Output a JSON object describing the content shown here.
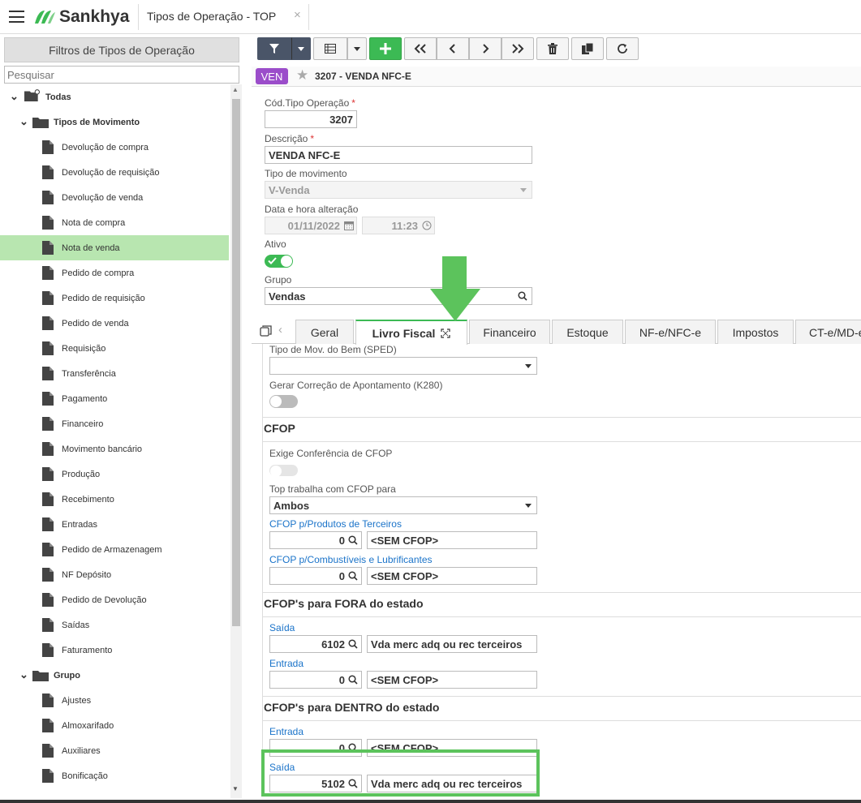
{
  "app": {
    "brand": "Sankhya",
    "doc_tab": "Tipos de Operação - TOP",
    "close": "×"
  },
  "colors": {
    "accent": "#3cba54",
    "badge": "#9b4dca",
    "selection": "#b8e6b0",
    "link": "#1a73c9"
  },
  "left": {
    "header": "Filtros de Tipos de Operação",
    "search_placeholder": "Pesquisar",
    "tree": [
      {
        "label": "Todas",
        "level": 0,
        "type": "root"
      },
      {
        "label": "Tipos de Movimento",
        "level": 1,
        "type": "folder"
      },
      {
        "label": "Devolução de compra",
        "level": 2,
        "type": "file"
      },
      {
        "label": "Devolução de requisição",
        "level": 2,
        "type": "file"
      },
      {
        "label": "Devolução de venda",
        "level": 2,
        "type": "file"
      },
      {
        "label": "Nota de compra",
        "level": 2,
        "type": "file"
      },
      {
        "label": "Nota de venda",
        "level": 2,
        "type": "file",
        "selected": true
      },
      {
        "label": "Pedido de compra",
        "level": 2,
        "type": "file"
      },
      {
        "label": "Pedido de requisição",
        "level": 2,
        "type": "file"
      },
      {
        "label": "Pedido de venda",
        "level": 2,
        "type": "file"
      },
      {
        "label": "Requisição",
        "level": 2,
        "type": "file"
      },
      {
        "label": "Transferência",
        "level": 2,
        "type": "file"
      },
      {
        "label": "Pagamento",
        "level": 2,
        "type": "file"
      },
      {
        "label": "Financeiro",
        "level": 2,
        "type": "file"
      },
      {
        "label": "Movimento bancário",
        "level": 2,
        "type": "file"
      },
      {
        "label": "Produção",
        "level": 2,
        "type": "file"
      },
      {
        "label": "Recebimento",
        "level": 2,
        "type": "file"
      },
      {
        "label": "Entradas",
        "level": 2,
        "type": "file"
      },
      {
        "label": "Pedido de Armazenagem",
        "level": 2,
        "type": "file"
      },
      {
        "label": "NF Depósito",
        "level": 2,
        "type": "file"
      },
      {
        "label": "Pedido de Devolução",
        "level": 2,
        "type": "file"
      },
      {
        "label": "Saídas",
        "level": 2,
        "type": "file"
      },
      {
        "label": "Faturamento",
        "level": 2,
        "type": "file"
      },
      {
        "label": "Grupo",
        "level": 1,
        "type": "folder"
      },
      {
        "label": "Ajustes",
        "level": 2,
        "type": "file"
      },
      {
        "label": "Almoxarifado",
        "level": 2,
        "type": "file"
      },
      {
        "label": "Auxiliares",
        "level": 2,
        "type": "file"
      },
      {
        "label": "Bonificação",
        "level": 2,
        "type": "file"
      }
    ]
  },
  "record": {
    "badge": "VEN",
    "title": "3207 - VENDA NFC-E"
  },
  "form": {
    "cod_label": "Cód.Tipo Operação",
    "cod_value": "3207",
    "req": "*",
    "desc_label": "Descrição",
    "desc_value": "VENDA NFC-E",
    "tipo_label": "Tipo de movimento",
    "tipo_value": "V-Venda",
    "data_label": "Data e hora alteração",
    "data_value": "01/11/2022",
    "hora_value": "11:23",
    "ativo_label": "Ativo",
    "grupo_label": "Grupo",
    "grupo_value": "Vendas"
  },
  "tabs": [
    "Geral",
    "Livro Fiscal",
    "Financeiro",
    "Estoque",
    "NF-e/NFC-e",
    "Impostos",
    "CT-e/MD-e"
  ],
  "fiscal": {
    "sped_label": "Tipo de Mov. do Bem (SPED)",
    "k280_label": "Gerar Correção de Apontamento (K280)",
    "cfop_title": "CFOP",
    "exige_label": "Exige Conferência de CFOP",
    "top_label": "Top trabalha com CFOP para",
    "top_value": "Ambos",
    "terc_label": "CFOP p/Produtos de Terceiros",
    "terc_code": "0",
    "terc_desc": "<SEM CFOP>",
    "comb_label": "CFOP p/Combustíveis e Lubrificantes",
    "comb_code": "0",
    "comb_desc": "<SEM CFOP>",
    "fora_title": "CFOP's para FORA do estado",
    "fora_saida_label": "Saída",
    "fora_saida_code": "6102",
    "fora_saida_desc": "Vda merc adq ou rec terceiros",
    "fora_entrada_label": "Entrada",
    "fora_entrada_code": "0",
    "fora_entrada_desc": "<SEM CFOP>",
    "dentro_title": "CFOP's para DENTRO do estado",
    "dentro_entrada_label": "Entrada",
    "dentro_entrada_code": "0",
    "dentro_entrada_desc": "<SEM CFOP>",
    "dentro_saida_label": "Saída",
    "dentro_saida_code": "5102",
    "dentro_saida_desc": "Vda merc adq ou rec terceiros"
  }
}
